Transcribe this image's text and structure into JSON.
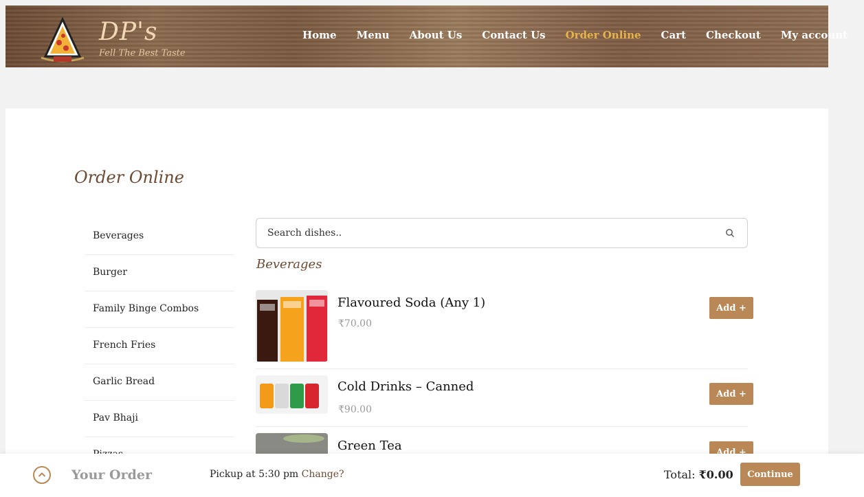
{
  "brand": {
    "name": "DP's",
    "tagline": "Fell The Best Taste"
  },
  "nav": [
    {
      "label": "Home"
    },
    {
      "label": "Menu"
    },
    {
      "label": "About Us"
    },
    {
      "label": "Contact Us"
    },
    {
      "label": "Order Online",
      "active": true
    },
    {
      "label": "Cart"
    },
    {
      "label": "Checkout"
    },
    {
      "label": "My account"
    }
  ],
  "page": {
    "title": "Order Online"
  },
  "categories": [
    "Beverages",
    "Burger",
    "Family Binge Combos",
    "French Fries",
    "Garlic Bread",
    "Pav Bhaji",
    "Pizzas"
  ],
  "search": {
    "placeholder": "Search dishes.."
  },
  "section": {
    "title": "Beverages"
  },
  "items": [
    {
      "name": "Flavoured Soda (Any 1)",
      "price": "₹70.00",
      "add_label": "Add +"
    },
    {
      "name": "Cold Drinks – Canned",
      "price": "₹90.00",
      "add_label": "Add +"
    },
    {
      "name": "Green Tea",
      "price": "",
      "add_label": "Add +"
    }
  ],
  "bottom_bar": {
    "title": "Your Order",
    "pickup_text": "Pickup at 5:30 pm",
    "change_label": "Change?",
    "total_label": "Total:",
    "total_value": "₹0.00",
    "continue_label": "Continue"
  },
  "colors": {
    "accent": "#b98856",
    "active_nav": "#e7b24d",
    "brand_brown": "#6b4a33"
  }
}
